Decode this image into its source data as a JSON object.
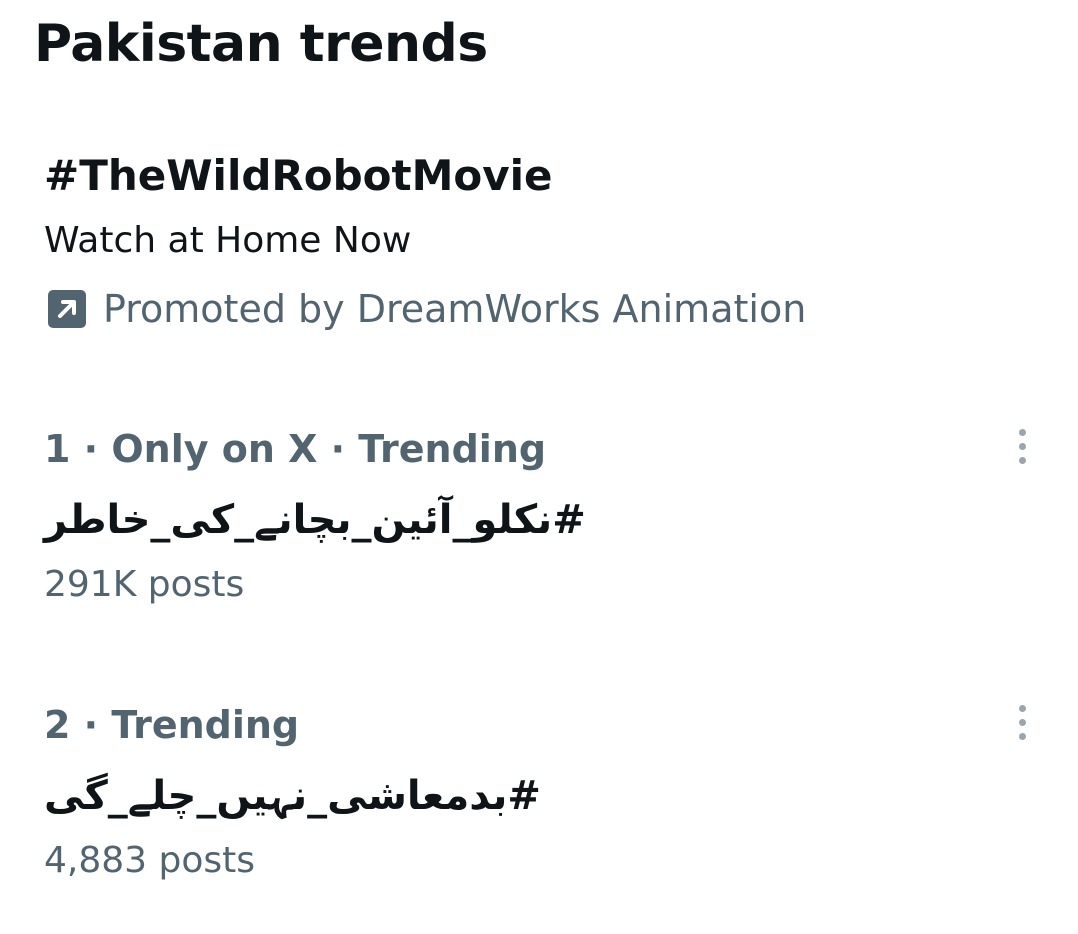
{
  "page": {
    "title": "Pakistan trends"
  },
  "promoted": {
    "title": "#TheWildRobotMovie",
    "subtitle": "Watch at Home Now",
    "promoted_by": "Promoted by DreamWorks Animation",
    "icon": "promoted-arrow-icon"
  },
  "trends": [
    {
      "meta": "1 · Only on X · Trending",
      "name": "#نکلو_آئین_بچانے_کی_خاطر",
      "posts": "291K posts",
      "menu_icon": "more-vertical-icon"
    },
    {
      "meta": "2 · Trending",
      "name": "#بدمعاشی_نہیں_چلے_گی",
      "posts": "4,883 posts",
      "menu_icon": "more-vertical-icon"
    }
  ],
  "colors": {
    "primary_text": "#0f1419",
    "secondary_text": "#536471",
    "menu_dots": "#9aa5ae",
    "background": "#ffffff"
  }
}
